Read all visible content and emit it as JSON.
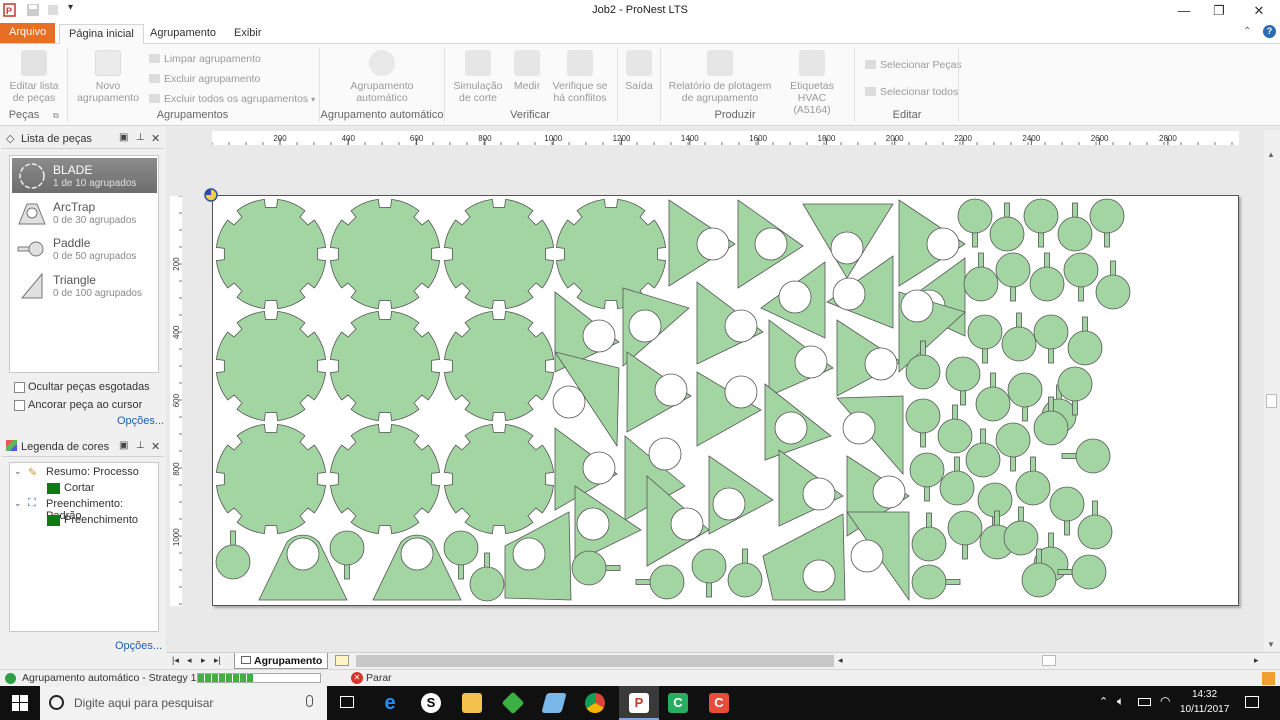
{
  "window": {
    "title": "Job2 - ProNest LTS"
  },
  "tabs": [
    "Arquivo",
    "Página inicial",
    "Agrupamento",
    "Exibir"
  ],
  "ribbon": {
    "editar_lista": [
      "Editar lista",
      "de peças"
    ],
    "novo_agrupamento": [
      "Novo",
      "agrupamento"
    ],
    "limpar": "Limpar agrupamento",
    "excluir": "Excluir agrupamento",
    "excluir_todos": "Excluir todos os agrupamentos",
    "agrupamento_auto": [
      "Agrupamento",
      "automático"
    ],
    "simulacao": [
      "Simulação",
      "de corte"
    ],
    "medir": "Medir",
    "verifique": [
      "Verifique se",
      "há conflitos"
    ],
    "saida": "Saída",
    "relatorio": [
      "Relatório de plotagem",
      "de agrupamento"
    ],
    "etiquetas": [
      "Etiquetas",
      "HVAC (A5164)"
    ],
    "selecionar_pecas": "Selecionar Peças",
    "selecionar_todos": "Selecionar todos",
    "groups": {
      "pecas": "Peças",
      "agrupamentos": "Agrupamentos",
      "agrupamento_automatico": "Agrupamento automático",
      "verificar": "Verificar",
      "produzir": "Produzir",
      "editar": "Editar"
    }
  },
  "parts_panel": {
    "title": "Lista de peças",
    "items": [
      {
        "name": "BLADE",
        "count": "1 de 10 agrupados"
      },
      {
        "name": "ArcTrap",
        "count": "0 de 30 agrupados"
      },
      {
        "name": "Paddle",
        "count": "0 de 50 agrupados"
      },
      {
        "name": "Triangle",
        "count": "0 de 100 agrupados"
      }
    ],
    "hide_label": "Ocultar peças esgotadas",
    "anchor_label": "Ancorar peça ao cursor",
    "options": "Opções..."
  },
  "legend_panel": {
    "title": "Legenda de cores",
    "summary": "Resumo: Processo",
    "cut": "Cortar",
    "fill_title": "Preenchimento: Padrão",
    "fill": "Preenchimento",
    "options": "Opções...",
    "cut_color": "#0b7a17",
    "fill_color": "#0b7a17"
  },
  "ruler": {
    "h": [
      "200",
      "400",
      "600",
      "800",
      "1000",
      "1200",
      "1400",
      "1600",
      "1800",
      "2000",
      "2200",
      "2400",
      "2600",
      "2800"
    ],
    "v": [
      "200",
      "400",
      "600",
      "800",
      "1000"
    ]
  },
  "sheet_tab": "Agrupamento 1",
  "status": {
    "text": "Agrupamento automático - Strategy 1:",
    "stop": "Parar",
    "progress": 0.45
  },
  "taskbar": {
    "search": "Digite aqui para pesquisar",
    "time": "14:32",
    "date": "10/11/2017"
  },
  "colors": {
    "part_fill": "#a3d5a3",
    "part_stroke": "#555555",
    "accent": "#e86d25"
  }
}
